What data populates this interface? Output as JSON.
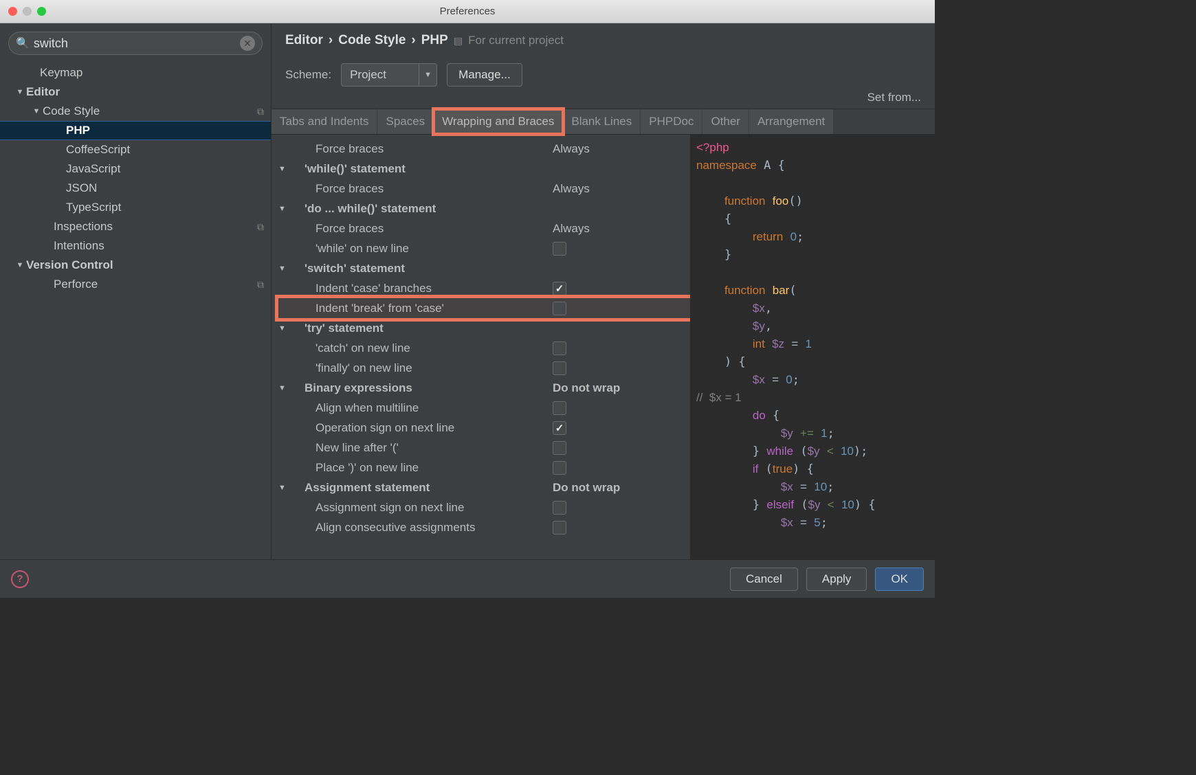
{
  "window": {
    "title": "Preferences"
  },
  "search": {
    "value": "switch",
    "placeholder": ""
  },
  "sidebar": {
    "items": [
      {
        "label": "Keymap",
        "indent": 42,
        "arrow": ""
      },
      {
        "label": "Editor",
        "indent": 22,
        "arrow": "▼",
        "bold": true
      },
      {
        "label": "Code Style",
        "indent": 46,
        "arrow": "▼",
        "copy": true
      },
      {
        "label": "PHP",
        "indent": 80,
        "arrow": "",
        "selected": true
      },
      {
        "label": "CoffeeScript",
        "indent": 80,
        "arrow": ""
      },
      {
        "label": "JavaScript",
        "indent": 80,
        "arrow": ""
      },
      {
        "label": "JSON",
        "indent": 80,
        "arrow": ""
      },
      {
        "label": "TypeScript",
        "indent": 80,
        "arrow": ""
      },
      {
        "label": "Inspections",
        "indent": 62,
        "arrow": "",
        "copy": true
      },
      {
        "label": "Intentions",
        "indent": 62,
        "arrow": ""
      },
      {
        "label": "Version Control",
        "indent": 22,
        "arrow": "▼",
        "bold": true
      },
      {
        "label": "Perforce",
        "indent": 62,
        "arrow": "",
        "copy": true
      }
    ]
  },
  "breadcrumb": {
    "a": "Editor",
    "b": "Code Style",
    "c": "PHP",
    "note": "For current project"
  },
  "scheme": {
    "label": "Scheme:",
    "value": "Project",
    "manage": "Manage...",
    "setfrom": "Set from..."
  },
  "tabs": [
    {
      "label": "Tabs and Indents"
    },
    {
      "label": "Spaces"
    },
    {
      "label": "Wrapping and Braces",
      "highlight": true,
      "active": true
    },
    {
      "label": "Blank Lines"
    },
    {
      "label": "PHPDoc"
    },
    {
      "label": "Other"
    },
    {
      "label": "Arrangement"
    }
  ],
  "settings": [
    {
      "type": "item",
      "label": "Force braces",
      "value": "Always",
      "indent": 2
    },
    {
      "type": "group",
      "label": "'while()' statement"
    },
    {
      "type": "item",
      "label": "Force braces",
      "value": "Always",
      "indent": 2
    },
    {
      "type": "group",
      "label": "'do ... while()' statement"
    },
    {
      "type": "item",
      "label": "Force braces",
      "value": "Always",
      "indent": 2
    },
    {
      "type": "check",
      "label": "'while' on new line",
      "checked": false,
      "indent": 2
    },
    {
      "type": "group",
      "label": "'switch' statement"
    },
    {
      "type": "check",
      "label": "Indent 'case' branches",
      "checked": true,
      "indent": 2
    },
    {
      "type": "check",
      "label": "Indent 'break' from 'case'",
      "checked": false,
      "indent": 2,
      "highlight": true
    },
    {
      "type": "group",
      "label": "'try' statement"
    },
    {
      "type": "check",
      "label": "'catch' on new line",
      "checked": false,
      "indent": 2
    },
    {
      "type": "check",
      "label": "'finally' on new line",
      "checked": false,
      "indent": 2
    },
    {
      "type": "group",
      "label": "Binary expressions",
      "value": "Do not wrap"
    },
    {
      "type": "check",
      "label": "Align when multiline",
      "checked": false,
      "indent": 2
    },
    {
      "type": "check",
      "label": "Operation sign on next line",
      "checked": true,
      "indent": 2
    },
    {
      "type": "check",
      "label": "New line after '('",
      "checked": false,
      "indent": 2
    },
    {
      "type": "check",
      "label": "Place ')' on new line",
      "checked": false,
      "indent": 2
    },
    {
      "type": "group",
      "label": "Assignment statement",
      "value": "Do not wrap"
    },
    {
      "type": "check",
      "label": "Assignment sign on next line",
      "checked": false,
      "indent": 2
    },
    {
      "type": "check",
      "label": "Align consecutive assignments",
      "checked": false,
      "indent": 2
    }
  ],
  "footer": {
    "cancel": "Cancel",
    "apply": "Apply",
    "ok": "OK"
  }
}
